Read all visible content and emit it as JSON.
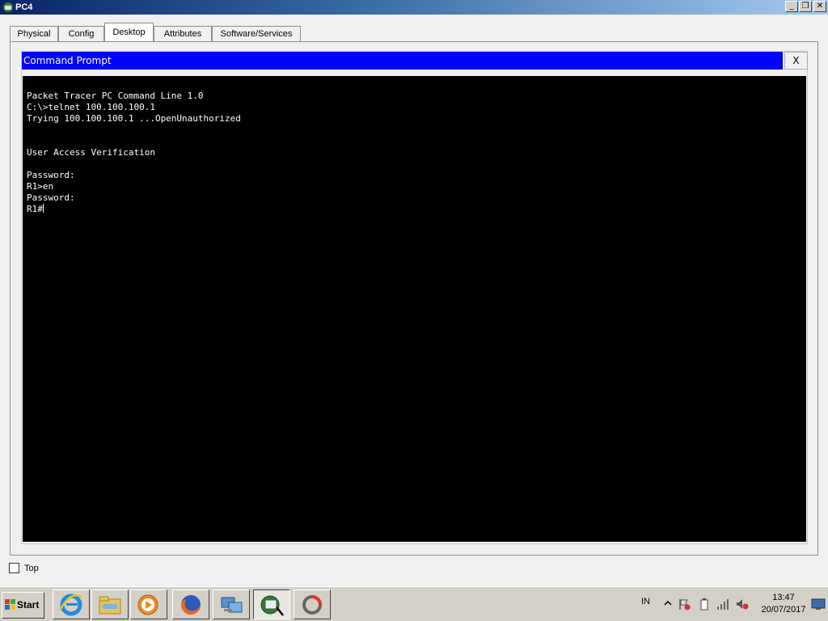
{
  "window": {
    "title": "PC4",
    "controls": {
      "minimize": "_",
      "restore": "❐",
      "close": "✕"
    }
  },
  "tabs": [
    {
      "label": "Physical",
      "active": false
    },
    {
      "label": "Config",
      "active": false
    },
    {
      "label": "Desktop",
      "active": true
    },
    {
      "label": "Attributes",
      "active": false
    },
    {
      "label": "Software/Services",
      "active": false
    }
  ],
  "command_prompt": {
    "title": "Command Prompt",
    "close_label": "X",
    "title_bar_color": "#0000ff",
    "lines": [
      "Packet Tracer PC Command Line 1.0",
      "C:\\>telnet 100.100.100.1",
      "Trying 100.100.100.1 ...OpenUnauthorized",
      "",
      "",
      "User Access Verification",
      "",
      "Password: ",
      "R1>en",
      "Password: "
    ],
    "prompt": "R1#"
  },
  "top_checkbox": {
    "label": "Top",
    "checked": false
  },
  "taskbar": {
    "start_label": "Start",
    "buttons": [
      {
        "icon": "internet-explorer-icon"
      },
      {
        "icon": "file-explorer-icon"
      },
      {
        "icon": "media-player-icon"
      },
      {
        "icon": "firefox-icon"
      },
      {
        "icon": "network-computers-icon"
      },
      {
        "icon": "packet-tracer-icon",
        "active": true
      },
      {
        "icon": "sync-app-icon"
      }
    ],
    "tray": {
      "language": "IN",
      "icons": [
        "show-hidden-icons-chevron-icon",
        "action-center-flag-icon",
        "battery-icon",
        "network-signal-icon",
        "volume-muted-icon"
      ],
      "time": "13:47",
      "date": "20/07/2017"
    }
  }
}
